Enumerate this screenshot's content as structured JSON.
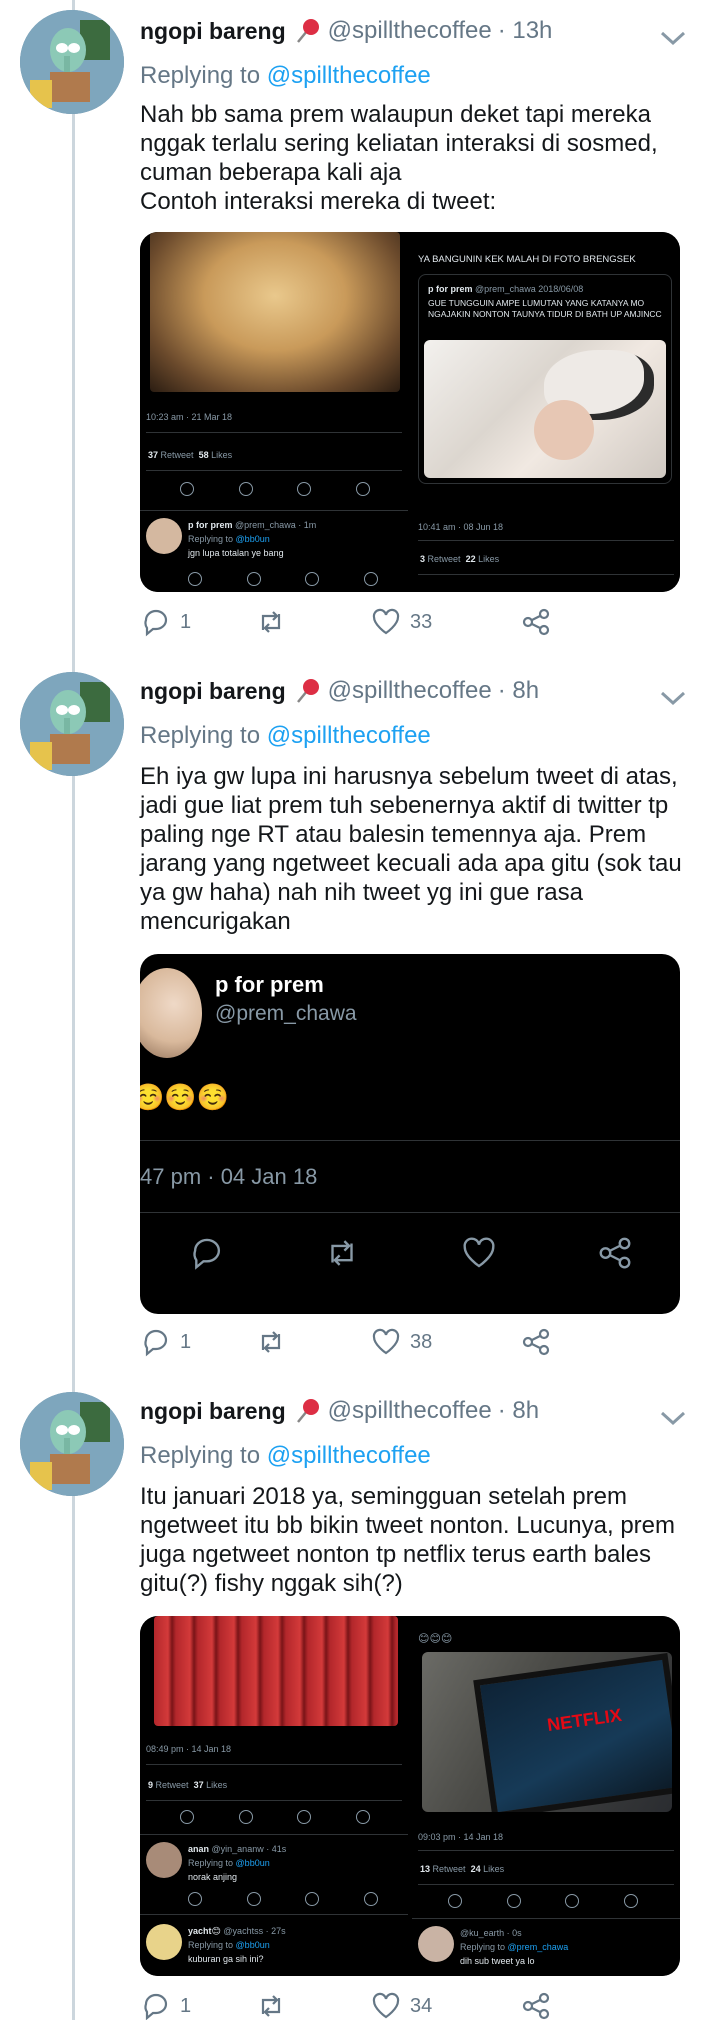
{
  "colors": {
    "accent": "#1da1f2",
    "muted": "#657786",
    "text": "#14171a",
    "media_bg": "#000000"
  },
  "tweets": [
    {
      "name": "ngopi bareng",
      "name_emoji": "📌",
      "handle": "@spillthecoffee",
      "time": "· 13h",
      "replying_label": "Replying to",
      "replying_to": "@spillthecoffee",
      "text": "Nah bb sama prem walaupun deket tapi mereka nggak terlalu sering keliatan interaksi di sosmed, cuman beberapa kali aja\nContoh interaksi mereka di tweet:",
      "stats": {
        "replies": "1",
        "retweets": "",
        "likes": "33"
      },
      "media": {
        "left": {
          "time": "10:23 am · 21 Mar 18",
          "retweets": "37",
          "retweets_label": "Retweet",
          "likes": "58",
          "likes_label": "Likes",
          "reply_name": "p for prem",
          "reply_handle": "@prem_chawa · 1m",
          "reply_replying": "Replying to",
          "reply_replying_to": "@bb0un",
          "reply_text": "jgn lupa totalan ye bang"
        },
        "right": {
          "caption": "YA BANGUNIN KEK MALAH DI FOTO BRENGSEK",
          "quoted_name": "p for prem",
          "quoted_handle": "@prem_chawa 2018/06/08",
          "quoted_text": "GUE TUNGGUIN AMPE LUMUTAN YANG KATANYA MO NGAJAKIN NONTON TAUNYA TIDUR DI BATH UP AMJINCC",
          "time": "10:41 am · 08 Jun 18",
          "retweets": "3",
          "retweets_label": "Retweet",
          "likes": "22",
          "likes_label": "Likes"
        }
      }
    },
    {
      "name": "ngopi bareng",
      "name_emoji": "📌",
      "handle": "@spillthecoffee",
      "time": "· 8h",
      "replying_label": "Replying to",
      "replying_to": "@spillthecoffee",
      "text": "Eh iya gw lupa ini harusnya sebelum tweet di atas, jadi gue liat prem tuh sebenernya aktif di twitter tp paling nge RT atau balesin temennya aja. Prem jarang yang ngetweet kecuali ada apa gitu (sok tau ya gw haha) nah nih tweet yg ini gue rasa mencurigakan",
      "stats": {
        "replies": "1",
        "retweets": "",
        "likes": "38"
      },
      "card": {
        "name": "p for prem",
        "handle": "@prem_chawa",
        "emoji": "☺️☺️☺️",
        "time": "47 pm · 04 Jan 18"
      }
    },
    {
      "name": "ngopi bareng",
      "name_emoji": "📌",
      "handle": "@spillthecoffee",
      "time": "· 8h",
      "replying_label": "Replying to",
      "replying_to": "@spillthecoffee",
      "text": "Itu januari 2018 ya, semingguan setelah prem ngetweet itu bb bikin tweet nonton. Lucunya, prem juga ngetweet nonton tp netflix terus earth bales gitu(?) fishy nggak sih(?)",
      "stats": {
        "replies": "1",
        "retweets": "",
        "likes": "34"
      },
      "media": {
        "left": {
          "time": "08:49 pm · 14 Jan 18",
          "retweets": "9",
          "retweets_label": "Retweet",
          "likes": "37",
          "likes_label": "Likes",
          "reply1_name": "anan",
          "reply1_handle": "@yin_ananw · 41s",
          "reply1_replying": "Replying to",
          "reply1_replying_to": "@bb0un",
          "reply1_text": "norak anjing",
          "reply2_name": "yacht😊",
          "reply2_handle": "@yachtss · 27s",
          "reply2_replying": "Replying to",
          "reply2_replying_to": "@bb0un",
          "reply2_text": "kuburan ga sih ini?"
        },
        "right": {
          "emoji": "😊😊😊",
          "netflix": "NETFLIX",
          "time": "09:03 pm · 14 Jan 18",
          "retweets": "13",
          "retweets_label": "Retweet",
          "likes": "24",
          "likes_label": "Likes",
          "reply_handle": "@ku_earth · 0s",
          "reply_replying": "Replying to",
          "reply_replying_to": "@prem_chawa",
          "reply_text": "dih sub tweet ya lo"
        }
      }
    }
  ]
}
